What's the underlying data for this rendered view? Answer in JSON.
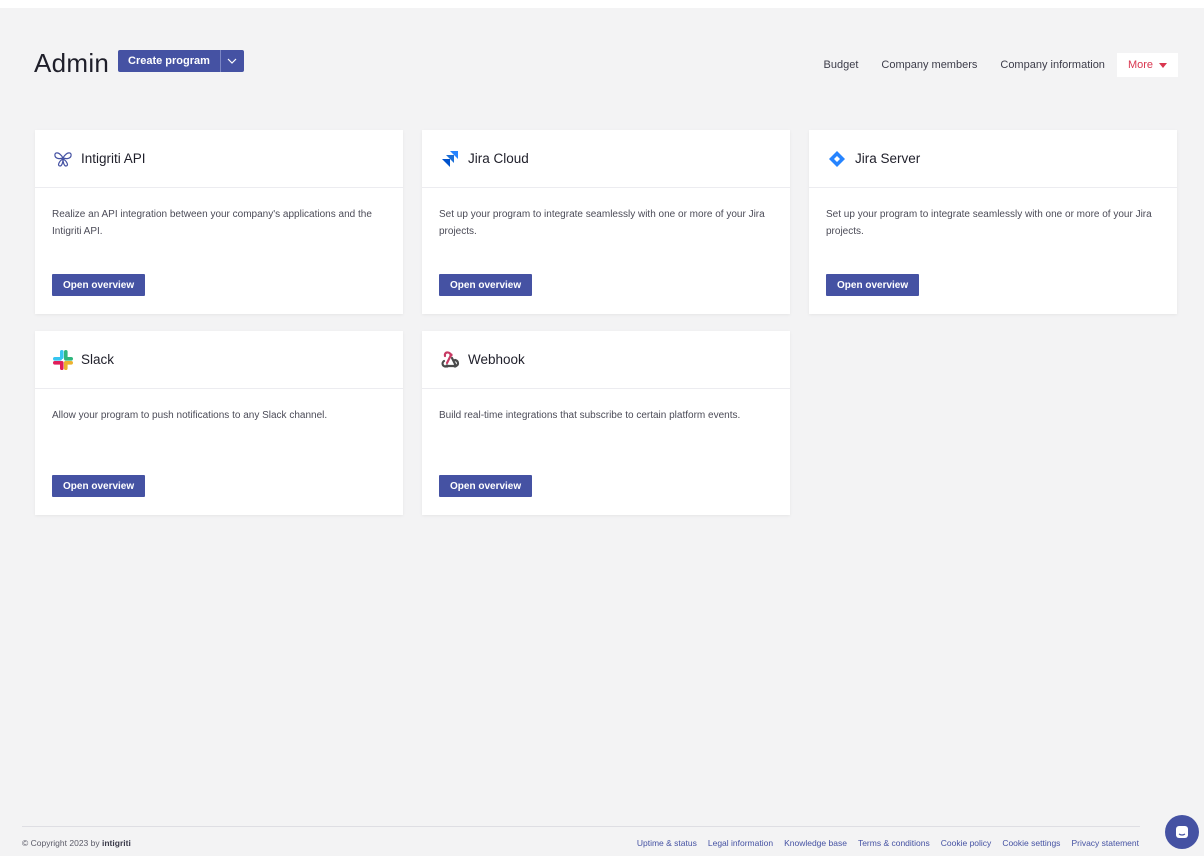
{
  "header": {
    "title": "Admin",
    "create_button": "Create program",
    "nav": [
      {
        "label": "Budget"
      },
      {
        "label": "Company members"
      },
      {
        "label": "Company information"
      }
    ],
    "more_label": "More"
  },
  "cards": [
    {
      "title": "Intigriti API",
      "description": "Realize an API integration between your company's applications and the Intigriti API.",
      "button": "Open overview",
      "icon": "intigriti-logo-icon"
    },
    {
      "title": "Jira Cloud",
      "description": "Set up your program to integrate seamlessly with one or more of your Jira projects.",
      "button": "Open overview",
      "icon": "jira-cloud-icon"
    },
    {
      "title": "Jira Server",
      "description": "Set up your program to integrate seamlessly with one or more of your Jira projects.",
      "button": "Open overview",
      "icon": "jira-server-icon"
    },
    {
      "title": "Slack",
      "description": "Allow your program to push notifications to any Slack channel.",
      "button": "Open overview",
      "icon": "slack-icon"
    },
    {
      "title": "Webhook",
      "description": "Build real-time integrations that subscribe to certain platform events.",
      "button": "Open overview",
      "icon": "webhook-icon"
    }
  ],
  "footer": {
    "copyright_prefix": "© Copyright 2023 by",
    "copyright_brand": "intigriti",
    "links": [
      {
        "label": "Uptime & status"
      },
      {
        "label": "Legal information"
      },
      {
        "label": "Knowledge base"
      },
      {
        "label": "Terms & conditions"
      },
      {
        "label": "Cookie policy"
      },
      {
        "label": "Cookie settings"
      },
      {
        "label": "Privacy statement"
      }
    ]
  },
  "colors": {
    "primary": "#4552a3",
    "accent": "#d9364f",
    "background": "#f3f3f4"
  }
}
